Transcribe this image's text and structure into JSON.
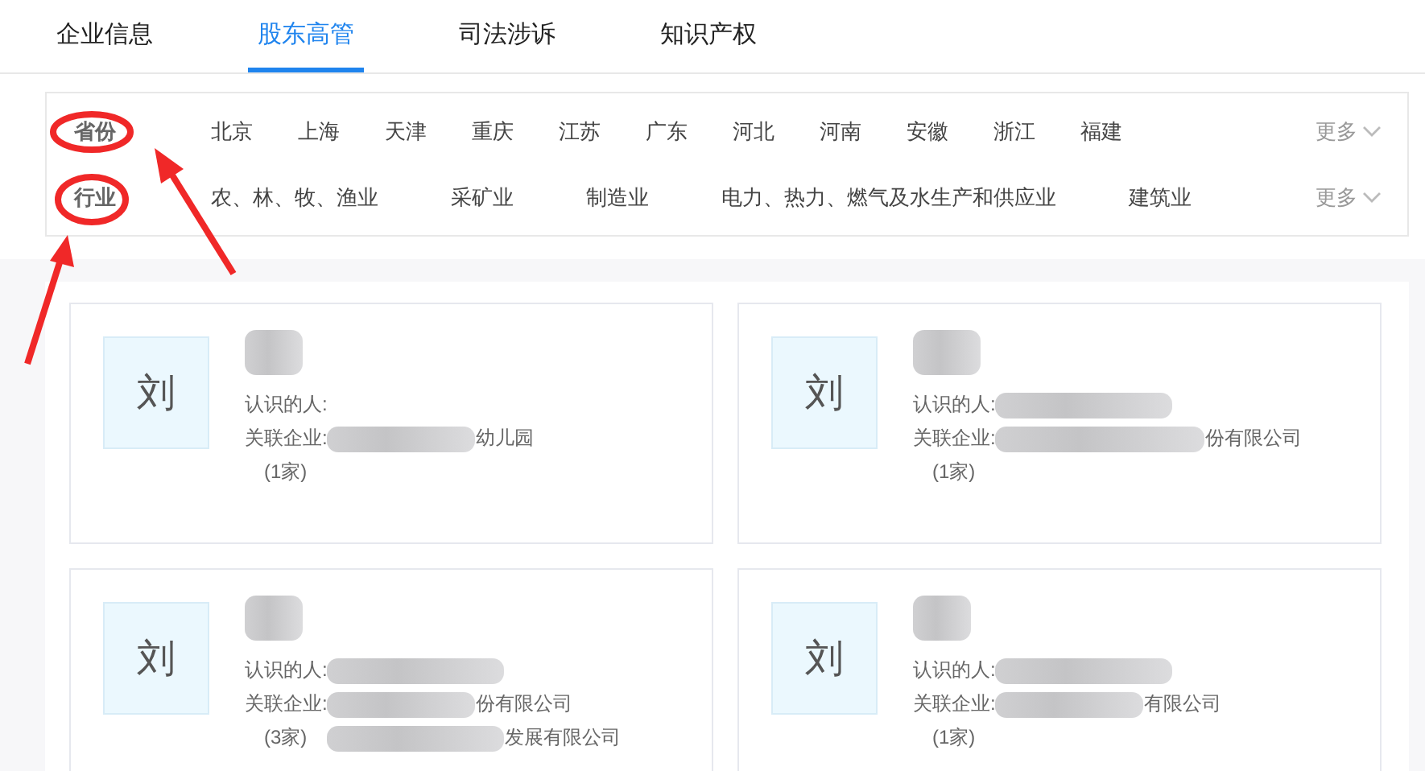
{
  "tabs": [
    {
      "label": "企业信息",
      "selected": false
    },
    {
      "label": "股东高管",
      "selected": true
    },
    {
      "label": "司法涉诉",
      "selected": false
    },
    {
      "label": "知识产权",
      "selected": false
    }
  ],
  "filters": [
    {
      "label": "省份",
      "options": [
        "北京",
        "上海",
        "天津",
        "重庆",
        "江苏",
        "广东",
        "河北",
        "河南",
        "安徽",
        "浙江",
        "福建"
      ],
      "more": "更多"
    },
    {
      "label": "行业",
      "options": [
        "农、林、牧、渔业",
        "采矿业",
        "制造业",
        "电力、热力、燃气及水生产和供应业",
        "建筑业"
      ],
      "more": "更多"
    }
  ],
  "cards": [
    {
      "avatar": "刘",
      "contacts_label": "认识的人:",
      "contacts_blurred": false,
      "company_label": "关联企业:",
      "companies": [
        "幼儿园"
      ],
      "count": "(1家)"
    },
    {
      "avatar": "刘",
      "contacts_label": "认识的人:",
      "contacts_blurred": true,
      "company_label": "关联企业:",
      "companies": [
        "份有限公司"
      ],
      "count": "(1家)"
    },
    {
      "avatar": "刘",
      "contacts_label": "认识的人:",
      "contacts_blurred": true,
      "company_label": "关联企业:",
      "companies": [
        "份有限公司",
        "发展有限公司"
      ],
      "count": "(3家)"
    },
    {
      "avatar": "刘",
      "contacts_label": "认识的人:",
      "contacts_blurred": true,
      "company_label": "关联企业:",
      "companies": [
        "有限公司"
      ],
      "count": "(1家)"
    }
  ]
}
